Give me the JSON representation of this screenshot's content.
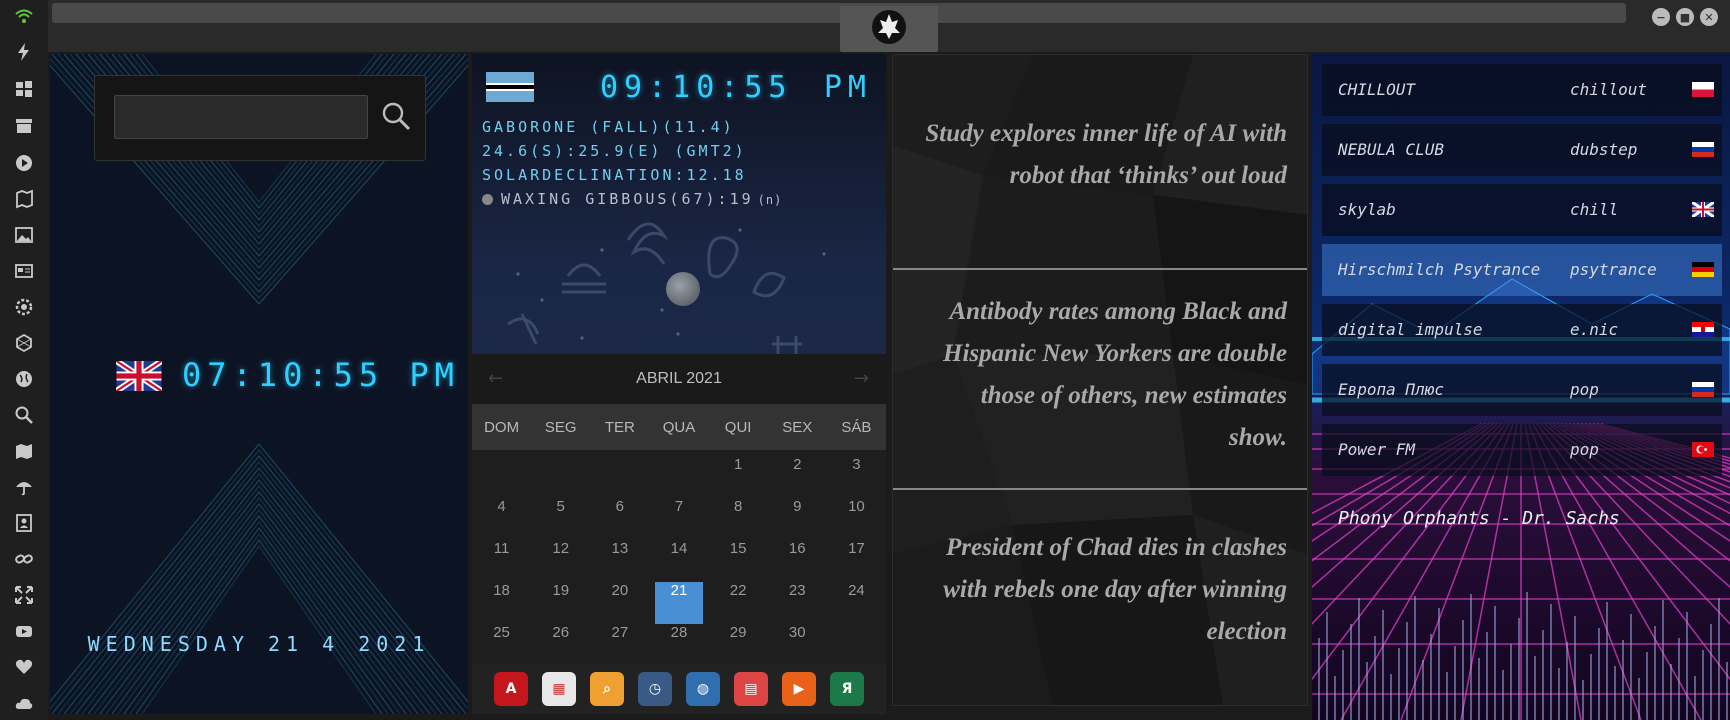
{
  "rail": {
    "icons": [
      "wifi-icon",
      "lightning-icon",
      "windows-icon",
      "archive-icon",
      "play-icon",
      "map-marker-icon",
      "image-icon",
      "news-icon",
      "cog-icon",
      "hexagon-icon",
      "globe-icon",
      "search-icon",
      "map-icon",
      "umbrella-icon",
      "contacts-icon",
      "link-icon",
      "expand-icon",
      "youtube-icon",
      "heart-icon",
      "cloud-icon"
    ],
    "accent": "#5ecb3d"
  },
  "titlebar": {
    "logo": "rebel-alliance-logo",
    "buttons": [
      "−",
      "■",
      "✕"
    ]
  },
  "clock": {
    "search_placeholder": "",
    "time": "07:10:55 PM",
    "date": "WEDNESDAY 21 4 2021",
    "flag": "uk-flag",
    "accent": "#2fd0ff"
  },
  "world": {
    "flag": "botswana-flag",
    "time": "09:10:55",
    "ampm": "PM",
    "line1": "GABORONE (FALL)(11.4)",
    "line2": "24.6(S):25.9(E) (GMT2)",
    "line3": "SOLARDECLINATION:12.18",
    "line4": "WAXING GIBBOUS(67):19",
    "hemisphere": "(n)"
  },
  "calendar": {
    "month": "ABRIL 2021",
    "weekdays": [
      "DOM",
      "SEG",
      "TER",
      "QUA",
      "QUI",
      "SEX",
      "SÁB"
    ],
    "days": [
      "",
      "",
      "",
      "",
      "1",
      "2",
      "3",
      "4",
      "5",
      "6",
      "7",
      "8",
      "9",
      "10",
      "11",
      "12",
      "13",
      "14",
      "15",
      "16",
      "17",
      "18",
      "19",
      "20",
      "21",
      "22",
      "23",
      "24",
      "25",
      "26",
      "27",
      "28",
      "29",
      "30",
      ""
    ],
    "today": "21",
    "today_color": "#4a8fd4"
  },
  "dock": {
    "items": [
      {
        "name": "acrobat-icon",
        "glyph": "A",
        "color": "#c4161c"
      },
      {
        "name": "calendar-app-icon",
        "glyph": "▦",
        "color": "#e8e8e8"
      },
      {
        "name": "search-app-icon",
        "glyph": "⌕",
        "color": "#f0a030"
      },
      {
        "name": "clock-app-icon",
        "glyph": "◷",
        "color": "#3a5a86"
      },
      {
        "name": "globe-app-icon",
        "glyph": "◍",
        "color": "#2f6fb0"
      },
      {
        "name": "date-app-icon",
        "glyph": "▤",
        "color": "#d44"
      },
      {
        "name": "arrow-app-icon",
        "glyph": "▶",
        "color": "#e8621a"
      },
      {
        "name": "yandex-icon",
        "glyph": "Я",
        "color": "#1c7a4a"
      }
    ]
  },
  "news": {
    "headlines": [
      "Study explores inner life of AI with robot that ‘thinks’ out loud",
      "Antibody rates among Black and Hispanic New Yorkers are double those of others, new estimates show.",
      "President of Chad dies in clashes with rebels one day after winning election"
    ]
  },
  "radio": {
    "stations": [
      {
        "name": "CHILLOUT",
        "genre": "chillout",
        "flag": "poland-flag"
      },
      {
        "name": "NEBULA CLUB",
        "genre": "dubstep",
        "flag": "russia-flag"
      },
      {
        "name": "skylab",
        "genre": "chill",
        "flag": "uk-flag"
      },
      {
        "name": "Hirschmilch Psytrance",
        "genre": "psytrance",
        "flag": "germany-flag"
      },
      {
        "name": "digital impulse",
        "genre": "e.nic",
        "flag": "croatia-flag"
      },
      {
        "name": "Европа Плюс",
        "genre": "pop",
        "flag": "russia-flag"
      },
      {
        "name": "Power FM",
        "genre": "pop",
        "flag": "turkey-flag"
      }
    ],
    "active_index": 3,
    "now_playing": "Phony Orphants - Dr. Sachs"
  }
}
